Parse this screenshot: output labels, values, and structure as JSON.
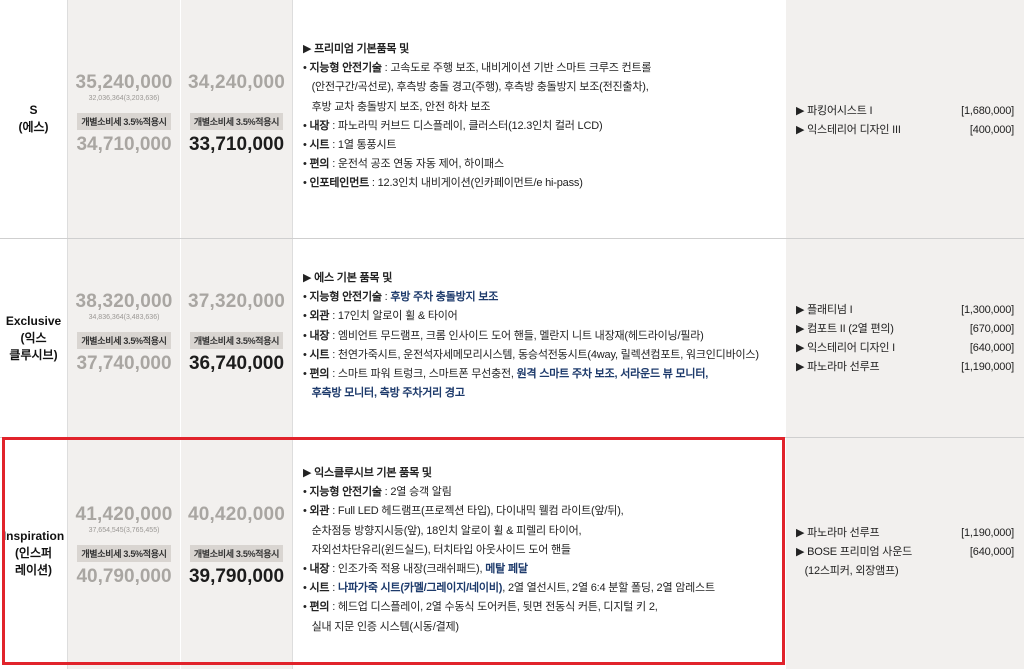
{
  "rows": [
    {
      "trim": "S\n(에스)",
      "price1": "35,240,000",
      "price1_sub": "32,036,364(3,203,636)",
      "price2": "34,240,000",
      "tax_label": "개별소비세 3.5%적용시",
      "price1_tax": "34,710,000",
      "price2_tax": "33,710,000",
      "lines": [
        [
          {
            "t": "▶ 프리미엄 기본품목 및",
            "s": "b"
          }
        ],
        [
          {
            "t": "• "
          },
          {
            "t": "지능형 안전기술",
            "s": "b"
          },
          {
            "t": " : 고속도로 주행 보조, 내비게이션 기반 스마트 크루즈 컨트롤"
          }
        ],
        [
          {
            "t": "   (안전구간/곡선로), 후측방 충돌 경고(주행), 후측방 충돌방지 보조(전진출차),"
          }
        ],
        [
          {
            "t": "   후방 교차 충돌방지 보조, 안전 하차 보조"
          }
        ],
        [
          {
            "t": "• "
          },
          {
            "t": "내장",
            "s": "b"
          },
          {
            "t": " : 파노라믹 커브드 디스플레이, 클러스터(12.3인치 컬러 LCD)"
          }
        ],
        [
          {
            "t": "• "
          },
          {
            "t": "시트",
            "s": "b"
          },
          {
            "t": " : 1열 통풍시트"
          }
        ],
        [
          {
            "t": "• "
          },
          {
            "t": "편의",
            "s": "b"
          },
          {
            "t": " : 운전석 공조 연동 자동 제어, 하이패스"
          }
        ],
        [
          {
            "t": "• "
          },
          {
            "t": "인포테인먼트",
            "s": "b"
          },
          {
            "t": " : 12.3인치 내비게이션(인카페이먼트/e hi-pass)"
          }
        ]
      ],
      "options": [
        {
          "name": "▶ 파킹어시스트 I",
          "price": "[1,680,000]"
        },
        {
          "name": "▶ 익스테리어 디자인 III",
          "price": "[400,000]"
        }
      ]
    },
    {
      "trim": "Exclusive\n(익스\n클루시브)",
      "price1": "38,320,000",
      "price1_sub": "34,836,364(3,483,636)",
      "price2": "37,320,000",
      "tax_label": "개별소비세 3.5%적용시",
      "price1_tax": "37,740,000",
      "price2_tax": "36,740,000",
      "lines": [
        [
          {
            "t": "▶ 에스 기본 품목 및",
            "s": "b"
          }
        ],
        [
          {
            "t": "• "
          },
          {
            "t": "지능형 안전기술",
            "s": "b"
          },
          {
            "t": " : "
          },
          {
            "t": "후방 주차 충돌방지 보조",
            "s": "bl"
          }
        ],
        [
          {
            "t": "• "
          },
          {
            "t": "외관",
            "s": "b"
          },
          {
            "t": " : 17인치 알로이 휠 & 타이어"
          }
        ],
        [
          {
            "t": "• "
          },
          {
            "t": "내장",
            "s": "b"
          },
          {
            "t": " : 엠비언트 무드램프, 크롬 인사이드 도어 핸들, 멜란지 니트 내장재(헤드라이닝/필라)"
          }
        ],
        [
          {
            "t": "• "
          },
          {
            "t": "시트",
            "s": "b"
          },
          {
            "t": " : 천연가죽시트, 운전석자세메모리시스템, 동승석전동시트(4way, 릴렉션컴포트, 워크인디바이스)"
          }
        ],
        [
          {
            "t": "• "
          },
          {
            "t": "편의",
            "s": "b"
          },
          {
            "t": " : 스마트 파워 트렁크, 스마트폰 무선충전, "
          },
          {
            "t": "원격 스마트 주차 보조, 서라운드 뷰 모니터,",
            "s": "bl"
          }
        ],
        [
          {
            "t": "   "
          },
          {
            "t": "후측방 모니터, 측방 주차거리 경고",
            "s": "bl"
          }
        ]
      ],
      "options": [
        {
          "name": "▶ 플래티넘 I",
          "price": "[1,300,000]"
        },
        {
          "name": "▶ 컴포트 II (2열 편의)",
          "price": "[670,000]"
        },
        {
          "name": "▶ 익스테리어 디자인 I",
          "price": "[640,000]"
        },
        {
          "name": "▶ 파노라마 선루프",
          "price": "[1,190,000]"
        }
      ]
    },
    {
      "trim": "Inspiration\n(인스퍼\n레이션)",
      "price1": "41,420,000",
      "price1_sub": "37,654,545(3,765,455)",
      "price2": "40,420,000",
      "tax_label": "개별소비세 3.5%적용시",
      "price1_tax": "40,790,000",
      "price2_tax": "39,790,000",
      "lines": [
        [
          {
            "t": "▶ 익스클루시브 기본 품목 및",
            "s": "b"
          }
        ],
        [
          {
            "t": "• "
          },
          {
            "t": "지능형 안전기술",
            "s": "b"
          },
          {
            "t": " : 2열 승객 알림"
          }
        ],
        [
          {
            "t": "• "
          },
          {
            "t": "외관",
            "s": "b"
          },
          {
            "t": " : Full LED 헤드램프(프로젝션 타입), 다이내믹 웰컴 라이트(앞/뒤),"
          }
        ],
        [
          {
            "t": "   순차점등 방향지시등(앞), 18인치 알로이 휠 & 피렐리 타이어,"
          }
        ],
        [
          {
            "t": "   자외선차단유리(윈드실드), 터치타입 아웃사이드 도어 핸들"
          }
        ],
        [
          {
            "t": "• "
          },
          {
            "t": "내장",
            "s": "b"
          },
          {
            "t": " : 인조가죽 적용 내장(크래쉬패드), "
          },
          {
            "t": "메탈 페달",
            "s": "bl"
          }
        ],
        [
          {
            "t": "• "
          },
          {
            "t": "시트",
            "s": "b"
          },
          {
            "t": " : "
          },
          {
            "t": "나파가죽 시트(카멜/그레이지/네이비)",
            "s": "bl"
          },
          {
            "t": ", 2열 열선시트, 2열 6:4 분할 폴딩, 2열 암레스트"
          }
        ],
        [
          {
            "t": "• "
          },
          {
            "t": "편의",
            "s": "b"
          },
          {
            "t": " : 헤드업 디스플레이, 2열 수동식 도어커튼, 뒷면 전동식 커튼, 디지털 키 2,"
          }
        ],
        [
          {
            "t": "   실내 지문 인증 시스템(시동/결제)"
          }
        ]
      ],
      "options": [
        {
          "name": "▶ 파노라마 선루프",
          "price": "[1,190,000]"
        },
        {
          "name": "▶ BOSE 프리미엄 사운드",
          "price": "[640,000]"
        },
        {
          "name": "   (12스피커, 외장앰프)",
          "price": ""
        }
      ]
    }
  ],
  "highlight_color": "#e1232b"
}
